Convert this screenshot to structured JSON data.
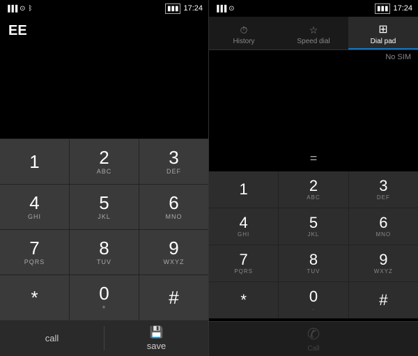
{
  "left_phone": {
    "status": {
      "signal": "▐▐▐",
      "wifi": "⊙",
      "bluetooth": "ᛒ",
      "battery": "▮▮",
      "time": "17:24"
    },
    "carrier": "EE",
    "dialpad": {
      "keys": [
        {
          "digit": "1",
          "sub": ""
        },
        {
          "digit": "2",
          "sub": "ABC"
        },
        {
          "digit": "3",
          "sub": "DEF"
        },
        {
          "digit": "4",
          "sub": "GHI"
        },
        {
          "digit": "5",
          "sub": "JKL"
        },
        {
          "digit": "6",
          "sub": "MNO"
        },
        {
          "digit": "7",
          "sub": "PQRS"
        },
        {
          "digit": "8",
          "sub": "TUV"
        },
        {
          "digit": "9",
          "sub": "WXYZ"
        },
        {
          "digit": "*",
          "sub": ""
        },
        {
          "digit": "0",
          "sub": "+"
        },
        {
          "digit": "#",
          "sub": ""
        }
      ]
    },
    "bottom": {
      "call_label": "call",
      "save_label": "save"
    }
  },
  "right_phone": {
    "status": {
      "signal": "▐▐▐",
      "wifi": "⊙",
      "battery": "▮▮",
      "time": "17:24"
    },
    "tabs": [
      {
        "label": "History",
        "icon": "⏱",
        "active": false
      },
      {
        "label": "Speed dial",
        "icon": "☆",
        "active": false
      },
      {
        "label": "Dial pad",
        "icon": "⊞",
        "active": true
      }
    ],
    "no_sim": "No SIM",
    "display": "=",
    "dialpad": {
      "keys": [
        {
          "digit": "1",
          "sub": ""
        },
        {
          "digit": "2",
          "sub": "ABC"
        },
        {
          "digit": "3",
          "sub": "DEF"
        },
        {
          "digit": "4",
          "sub": "GHI"
        },
        {
          "digit": "5",
          "sub": "JKL"
        },
        {
          "digit": "6",
          "sub": "MNO"
        },
        {
          "digit": "7",
          "sub": "PQRS"
        },
        {
          "digit": "8",
          "sub": "TUV"
        },
        {
          "digit": "9",
          "sub": "WXYZ"
        },
        {
          "digit": "*",
          "sub": ""
        },
        {
          "digit": "0",
          "sub": "."
        },
        {
          "digit": "#",
          "sub": ""
        }
      ]
    },
    "bottom": {
      "call_label": "Call",
      "call_icon": "✆"
    }
  }
}
